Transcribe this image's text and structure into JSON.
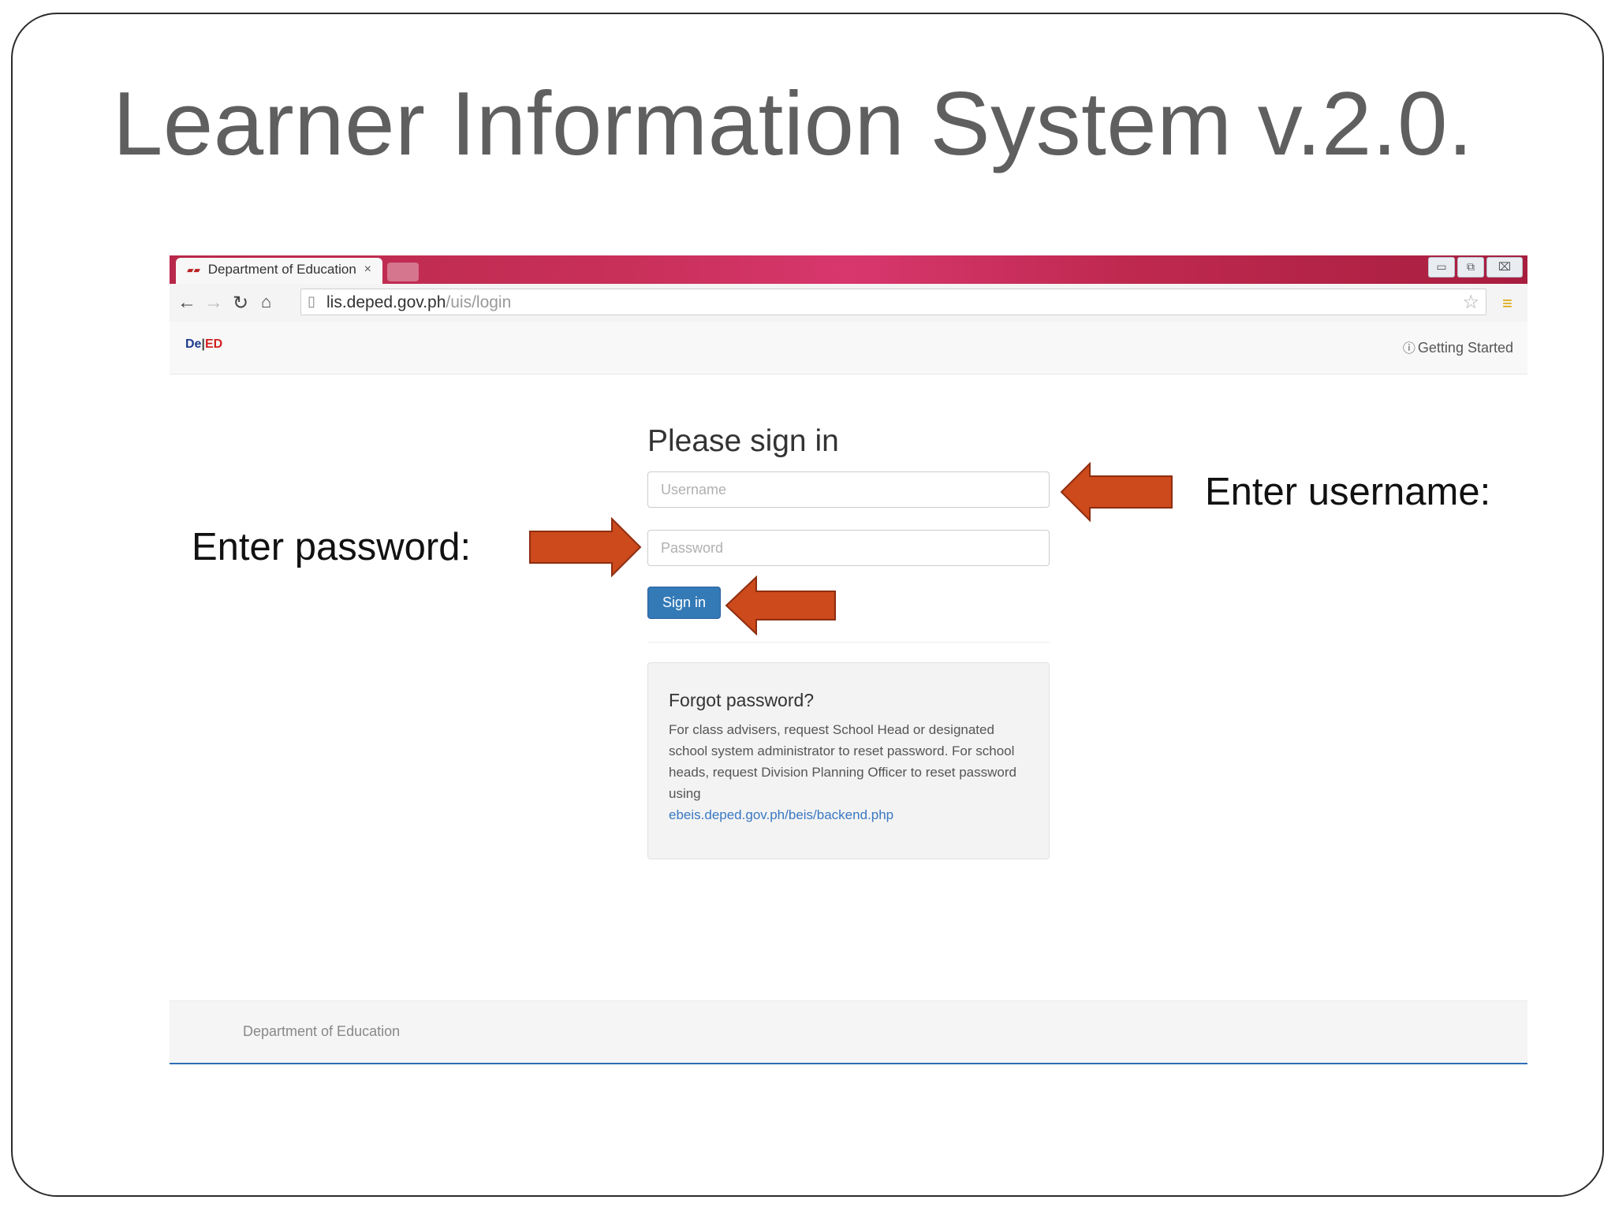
{
  "slide": {
    "title": "Learner Information System v.2.0.",
    "annotations": {
      "username": "Enter username:",
      "password": "Enter password:"
    },
    "arrow_color": "#cc4a1c"
  },
  "browser": {
    "tab": {
      "favicon": "deped-favicon",
      "title": "Department of Education",
      "close_glyph": "×"
    },
    "window_controls": {
      "minimize": "▭",
      "restore": "⧉",
      "close": "⌧"
    },
    "address_bar": {
      "host": "lis.deped.gov.ph",
      "path": "/uis/login"
    },
    "tab_strip_color": "#c42d56"
  },
  "header": {
    "logo": {
      "part1": "De",
      "part2": "ED"
    },
    "getting_started": "Getting Started"
  },
  "login": {
    "title": "Please sign in",
    "username_placeholder": "Username",
    "password_placeholder": "Password",
    "signin_label": "Sign in",
    "accent_color": "#337ab7"
  },
  "forgot": {
    "title": "Forgot password?",
    "text": "For class advisers, request School Head or designated school system administrator to reset password. For school heads, request Division Planning Officer to reset password using",
    "link": "ebeis.deped.gov.ph/beis/backend.php"
  },
  "footer": {
    "text": "Department of Education"
  }
}
